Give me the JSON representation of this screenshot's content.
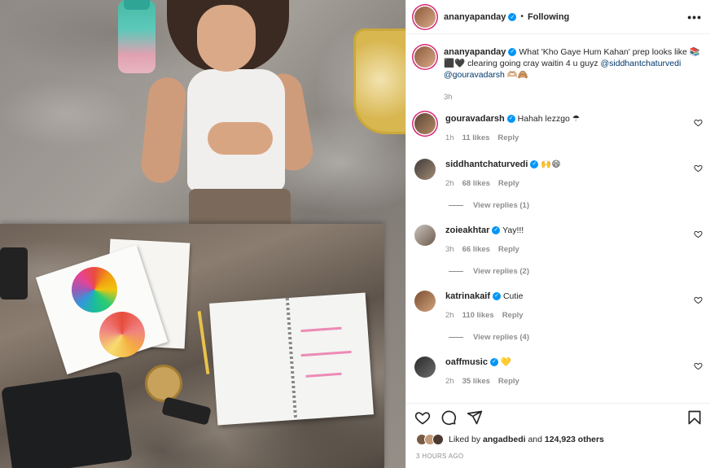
{
  "post": {
    "username": "ananyapanday",
    "follow_status": "Following",
    "more_label": "•••"
  },
  "caption": {
    "username": "ananyapanday",
    "text": "What 'Kho Gaye Hum Kahan' prep looks like 📚⬛🖤 clearing going cray waitin 4 u guyz",
    "mention_1": "@siddhantchaturvedi",
    "mention_2": "@gouravadarsh",
    "emoji_tail": "🫶🏼🙈",
    "time": "3h"
  },
  "comments": [
    {
      "username": "gouravadarsh",
      "text": "Hahah lezzgo ☂",
      "time": "1h",
      "likes": "11 likes",
      "reply": "Reply",
      "view_replies": ""
    },
    {
      "username": "siddhantchaturvedi",
      "text": "🙌😄",
      "time": "2h",
      "likes": "68 likes",
      "reply": "Reply",
      "view_replies": "View replies (1)"
    },
    {
      "username": "zoieakhtar",
      "text": "Yay!!!",
      "time": "3h",
      "likes": "66 likes",
      "reply": "Reply",
      "view_replies": "View replies (2)"
    },
    {
      "username": "katrinakaif",
      "text": "Cutie",
      "time": "2h",
      "likes": "110 likes",
      "reply": "Reply",
      "view_replies": "View replies (4)"
    },
    {
      "username": "oaffmusic",
      "text": "💛",
      "time": "2h",
      "likes": "35 likes",
      "reply": "Reply",
      "view_replies": ""
    }
  ],
  "likes": {
    "prefix": "Liked by",
    "user": "angadbedi",
    "and": "and",
    "others": "124,923 others"
  },
  "time_ago": "3 HOURS AGO",
  "icons": [
    "heart-icon",
    "comment-icon",
    "share-icon",
    "bookmark-icon",
    "verified-icon",
    "more-icon"
  ],
  "colors": {
    "link": "#00376b",
    "verified": "#0095f6",
    "muted": "#8e8e8e"
  }
}
